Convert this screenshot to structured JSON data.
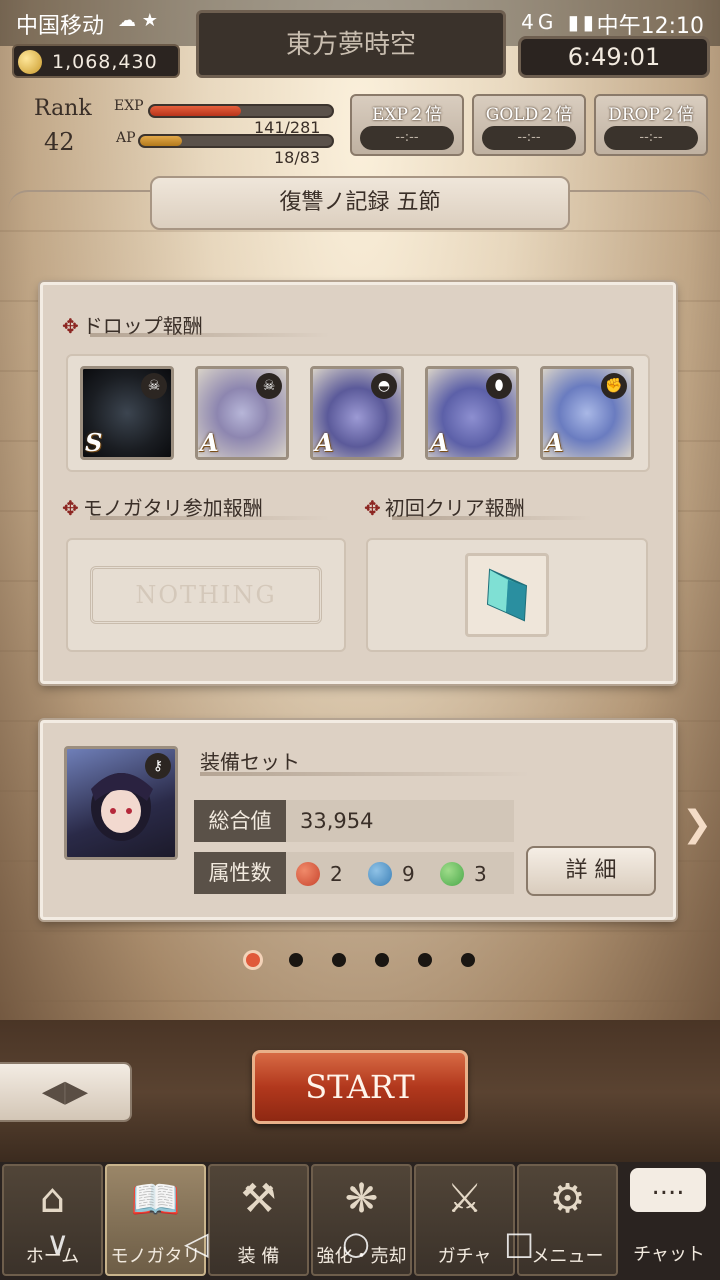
{
  "status_bar": {
    "carrier": "中国移动",
    "carrier_icons": "☁ ★",
    "system_icons": "🔕 ⏰ ᯤ 4G ▮▮",
    "clock": "中午12:10"
  },
  "hud": {
    "coins": "1,068,430",
    "title": "東方夢時空",
    "timer": "6:49:01",
    "rank_label": "Rank",
    "rank_value": "42",
    "exp_label": "EXP",
    "exp_value": "141/281",
    "exp_fraction": 0.5,
    "ap_label": "AP",
    "ap_value": "18/83",
    "ap_fraction": 0.22,
    "boosts": [
      {
        "label": "EXP２倍",
        "time": "--:--"
      },
      {
        "label": "GOLD２倍",
        "time": "--:--"
      },
      {
        "label": "DROP２倍",
        "time": "--:--"
      }
    ]
  },
  "chapter": {
    "title": "復讐ノ記録 五節"
  },
  "rewards": {
    "drop_title": "ドロップ報酬",
    "drop_items": [
      {
        "rank": "S",
        "icon": "skull-icon",
        "name": "armor-item"
      },
      {
        "rank": "A",
        "icon": "skull-icon",
        "name": "weapon-item"
      },
      {
        "rank": "A",
        "icon": "helmet-icon",
        "name": "dress-item"
      },
      {
        "rank": "A",
        "icon": "boot-icon",
        "name": "shoes-item"
      },
      {
        "rank": "A",
        "icon": "fist-icon",
        "name": "glove-item"
      }
    ],
    "participation_title": "モノガタリ参加報酬",
    "participation_value": "NOTHING",
    "first_clear_title": "初回クリア報酬"
  },
  "deck": {
    "title": "装備セット",
    "total_label": "総合値",
    "total_value": "33,954",
    "attr_label": "属性数",
    "attributes": [
      {
        "color": "#c8452e",
        "count": "2"
      },
      {
        "color": "#3b7fb6",
        "count": "9"
      },
      {
        "color": "#4aa84a",
        "count": "3"
      }
    ],
    "detail_button": "詳 細"
  },
  "pager": {
    "count": 6,
    "active": 0
  },
  "actions": {
    "back_icon": "◀▶",
    "start": "START"
  },
  "tabs": [
    {
      "label": "ホーム",
      "icon": "⌂"
    },
    {
      "label": "モノガタリ",
      "icon": "📖"
    },
    {
      "label": "装 備",
      "icon": "⚒"
    },
    {
      "label": "強化・売却",
      "icon": "❋"
    },
    {
      "label": "ガチャ",
      "icon": "⚔"
    },
    {
      "label": "メニュー",
      "icon": "⚙"
    }
  ],
  "chat": {
    "bubble": "....",
    "label": "チャット"
  },
  "nav": {
    "back": "◁",
    "home": "○",
    "recent": "□",
    "down": "∨"
  }
}
